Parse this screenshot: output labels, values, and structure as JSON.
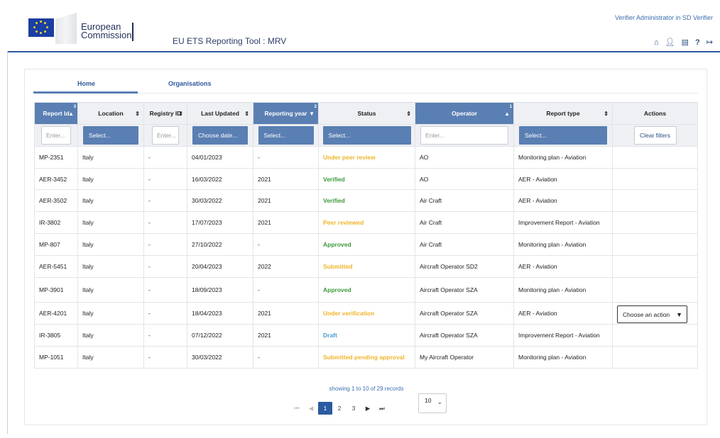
{
  "header": {
    "org_line1": "European",
    "org_line2": "Commission",
    "app_title": "EU ETS Reporting Tool : MRV",
    "user_role": "Verifier Administrator in SD Verifier",
    "icons": [
      "home-icon",
      "user-icon",
      "document-icon",
      "help-icon",
      "logout-icon"
    ]
  },
  "tabs": [
    {
      "label": "Home",
      "active": true
    },
    {
      "label": "Organisations",
      "active": false
    }
  ],
  "table": {
    "columns": [
      {
        "label": "Report Id",
        "sorted": "asc",
        "rank": "3",
        "active": true
      },
      {
        "label": "Location",
        "sortable": true
      },
      {
        "label": "Registry ID",
        "sortable": true
      },
      {
        "label": "Last Updated",
        "sortable": true
      },
      {
        "label": "Reporting year",
        "sorted": "desc",
        "rank": "2",
        "active": true
      },
      {
        "label": "Status",
        "sortable": true
      },
      {
        "label": "Operator",
        "sorted": "asc",
        "rank": "1",
        "active": true
      },
      {
        "label": "Report type",
        "sortable": true
      },
      {
        "label": "Actions"
      }
    ],
    "filters": {
      "report_id": "Enter...",
      "location": "Select...",
      "registry_id": "Enter...",
      "last_updated": "Choose date...",
      "reporting_year": "Select...",
      "status": "Select...",
      "operator": "Enter...",
      "report_type": "Select...",
      "clear_label": "Clear filters"
    },
    "rows": [
      {
        "id": "MP-2351",
        "location": "Italy",
        "registry": "-",
        "updated": "04/01/2023",
        "year": "-",
        "status": "Under peer review",
        "status_color": "#f0b429",
        "operator": "AO",
        "type": "Monitoring plan - Aviation"
      },
      {
        "id": "AER-3452",
        "location": "Italy",
        "registry": "-",
        "updated": "16/03/2022",
        "year": "2021",
        "status": "Verified",
        "status_color": "#3a9a3a",
        "operator": "AO",
        "type": "AER - Aviation"
      },
      {
        "id": "AER-3502",
        "location": "Italy",
        "registry": "-",
        "updated": "30/03/2022",
        "year": "2021",
        "status": "Verified",
        "status_color": "#3a9a3a",
        "operator": "Air Craft",
        "type": "AER - Aviation"
      },
      {
        "id": "IR-3802",
        "location": "Italy",
        "registry": "-",
        "updated": "17/07/2023",
        "year": "2021",
        "status": "Peer reviewed",
        "status_color": "#f0b429",
        "operator": "Air Craft",
        "type": "Improvement Report - Aviation"
      },
      {
        "id": "MP-807",
        "location": "Italy",
        "registry": "-",
        "updated": "27/10/2022",
        "year": "-",
        "status": "Approved",
        "status_color": "#3a9a3a",
        "operator": "Air Craft",
        "type": "Monitoring plan - Aviation"
      },
      {
        "id": "AER-5451",
        "location": "Italy",
        "registry": "-",
        "updated": "20/04/2023",
        "year": "2022",
        "status": "Submitted",
        "status_color": "#f0b429",
        "operator": "Aircraft Operator SD2",
        "type": "AER - Aviation"
      },
      {
        "id": "MP-3901",
        "location": "Italy",
        "registry": "-",
        "updated": "18/09/2023",
        "year": "-",
        "status": "Approved",
        "status_color": "#3a9a3a",
        "operator": "Aircraft Operator SZA",
        "type": "Monitoring plan - Aviation"
      },
      {
        "id": "AER-4201",
        "location": "Italy",
        "registry": "-",
        "updated": "18/04/2023",
        "year": "2021",
        "status": "Under verification",
        "status_color": "#f0b429",
        "operator": "Aircraft Operator SZA",
        "type": "AER - Aviation",
        "action": "Choose an action"
      },
      {
        "id": "IR-3805",
        "location": "Italy",
        "registry": "-",
        "updated": "07/12/2022",
        "year": "2021",
        "status": "Draft",
        "status_color": "#4a9ed0",
        "operator": "Aircraft Operator SZA",
        "type": "Improvement Report - Aviation"
      },
      {
        "id": "MP-1051",
        "location": "Italy",
        "registry": "-",
        "updated": "30/03/2022",
        "year": "-",
        "status": "Submitted pending approval",
        "status_color": "#f0b429",
        "operator": "My Aircraft Operator",
        "type": "Monitoring plan - Aviation"
      }
    ]
  },
  "pagination": {
    "records_text": "showing 1 to 10 of 29 records",
    "pages": [
      "1",
      "2",
      "3"
    ],
    "current_page": "1",
    "page_size": "10"
  }
}
